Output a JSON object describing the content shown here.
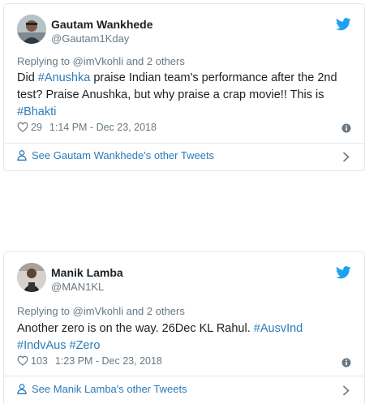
{
  "tweets": [
    {
      "name": "Gautam Wankhede",
      "handle": "@Gautam1Kday",
      "reply": {
        "prefix": "Replying to ",
        "mention": "@imVkohli",
        "suffix": " and 2 others"
      },
      "text": {
        "t1": "Did ",
        "h1": "#Anushka",
        "t2": " praise Indian team's performance after the 2nd test? Praise Anushka, but why praise a crap movie!! This is ",
        "h2": "#Bhakti"
      },
      "likes": "29",
      "timestamp": "1:14 PM - Dec 23, 2018",
      "more_label": "See Gautam Wankhede's other Tweets"
    },
    {
      "name": "Manik Lamba",
      "handle": "@MAN1KL",
      "reply": {
        "prefix": "Replying to ",
        "mention": "@imVkohli",
        "suffix": " and 2 others"
      },
      "text": {
        "t1": "Another zero is on the way. 26Dec KL Rahul. ",
        "h1": "#AusvInd",
        "t2": " ",
        "h2": "#IndvAus",
        "t3": " ",
        "h3": "#Zero"
      },
      "likes": "103",
      "timestamp": "1:23 PM - Dec 23, 2018",
      "more_label": "See Manik Lamba's other Tweets"
    }
  ],
  "colors": {
    "link": "#2b7bb9",
    "muted": "#697882",
    "border": "#e1e8ed",
    "twitter_blue": "#1da1f2"
  },
  "icons": [
    "twitter-bird-icon",
    "heart-icon",
    "info-icon",
    "person-icon",
    "chevron-right-icon"
  ]
}
